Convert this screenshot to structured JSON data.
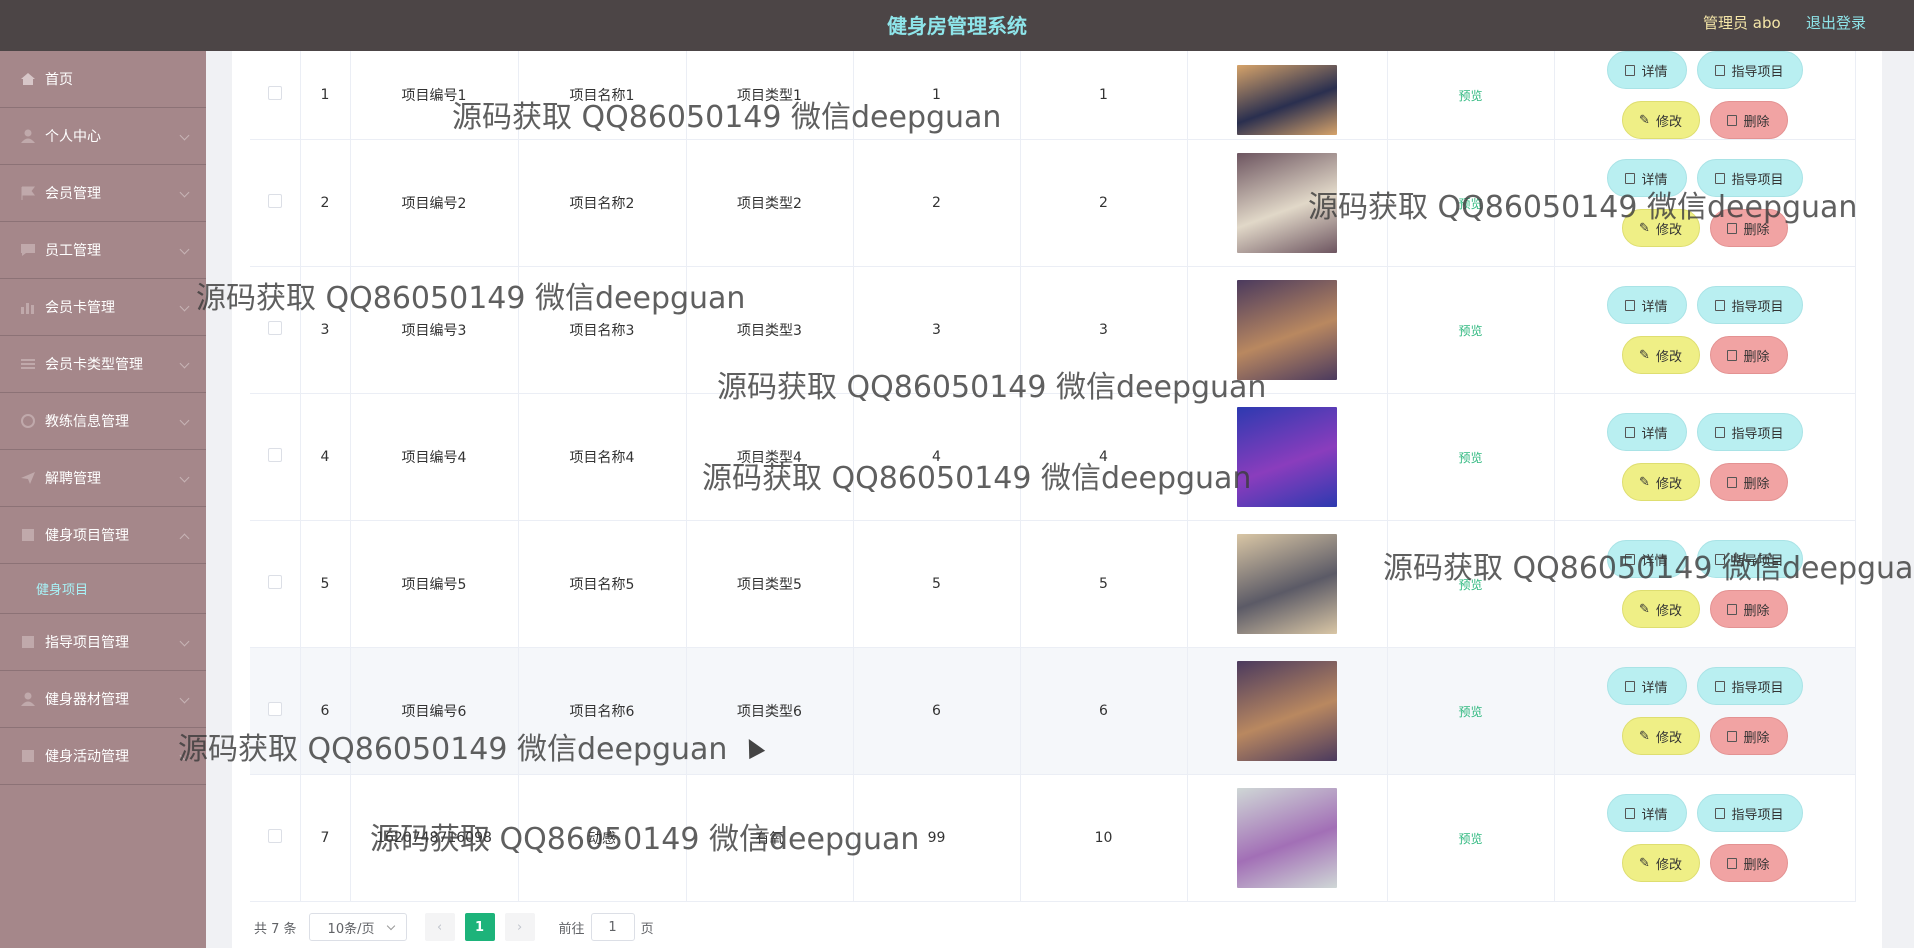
{
  "header": {
    "title": "健身房管理系统",
    "user": "管理员 abo",
    "logout": "退出登录"
  },
  "sidebar": {
    "items": [
      {
        "label": "首页",
        "icon": "home-icon"
      },
      {
        "label": "个人中心",
        "icon": "user-icon"
      },
      {
        "label": "会员管理",
        "icon": "flag-icon"
      },
      {
        "label": "员工管理",
        "icon": "chat-icon"
      },
      {
        "label": "会员卡管理",
        "icon": "chart-icon"
      },
      {
        "label": "会员卡类型管理",
        "icon": "list-icon"
      },
      {
        "label": "教练信息管理",
        "icon": "circle-icon"
      },
      {
        "label": "解聘管理",
        "icon": "send-icon"
      },
      {
        "label": "健身项目管理",
        "icon": "doc-icon"
      },
      {
        "label": "指导项目管理",
        "icon": "doc-icon"
      },
      {
        "label": "健身器材管理",
        "icon": "user-icon"
      },
      {
        "label": "健身活动管理",
        "icon": "doc-icon"
      }
    ],
    "active_sub": "健身项目"
  },
  "table": {
    "preview_label": "预览",
    "buttons": {
      "detail": "详情",
      "guide": "指导项目",
      "edit": "修改",
      "delete": "删除"
    },
    "rows": [
      {
        "index": "1",
        "code": "项目编号1",
        "name": "项目名称1",
        "type": "项目类型1",
        "c5": "1",
        "c6": "1"
      },
      {
        "index": "2",
        "code": "项目编号2",
        "name": "项目名称2",
        "type": "项目类型2",
        "c5": "2",
        "c6": "2"
      },
      {
        "index": "3",
        "code": "项目编号3",
        "name": "项目名称3",
        "type": "项目类型3",
        "c5": "3",
        "c6": "3"
      },
      {
        "index": "4",
        "code": "项目编号4",
        "name": "项目名称4",
        "type": "项目类型4",
        "c5": "4",
        "c6": "4"
      },
      {
        "index": "5",
        "code": "项目编号5",
        "name": "项目名称5",
        "type": "项目类型5",
        "c5": "5",
        "c6": "5"
      },
      {
        "index": "6",
        "code": "项目编号6",
        "name": "项目名称6",
        "type": "项目类型6",
        "c5": "6",
        "c6": "6"
      },
      {
        "index": "7",
        "code": "1620748716098",
        "name": "动感",
        "type": "有氧",
        "c5": "99",
        "c6": "10"
      }
    ]
  },
  "pagination": {
    "total": "共 7 条",
    "page_size": "10条/页",
    "current": "1",
    "goto_label": "前往",
    "goto_value": "1",
    "page_suffix": "页"
  },
  "watermark": "源码获取 QQ86050149 微信deepguan"
}
